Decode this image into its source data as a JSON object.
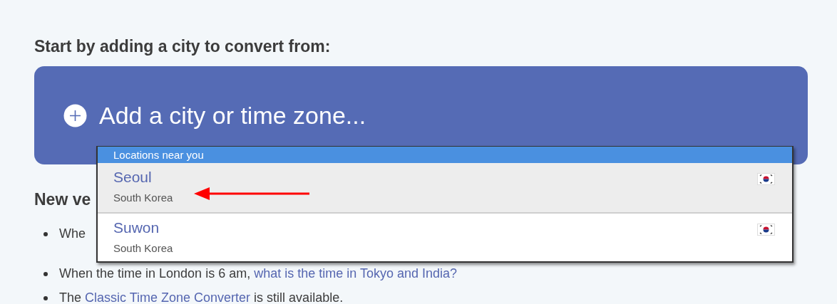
{
  "intro_heading": "Start by adding a city to convert from:",
  "add_city": {
    "placeholder": "Add a city or time zone..."
  },
  "dropdown": {
    "header": "Locations near you",
    "items": [
      {
        "city": "Seoul",
        "country": "South Korea",
        "selected": true
      },
      {
        "city": "Suwon",
        "country": "South Korea",
        "selected": false
      }
    ]
  },
  "section_heading": "New ve",
  "bullets": [
    {
      "before": "Whe"
    },
    {
      "before": "When the time in London is 6 am, ",
      "link": "what is the time in Tokyo and India?"
    },
    {
      "before": "The ",
      "link": "Classic Time Zone Converter",
      "after": " is still available."
    }
  ]
}
